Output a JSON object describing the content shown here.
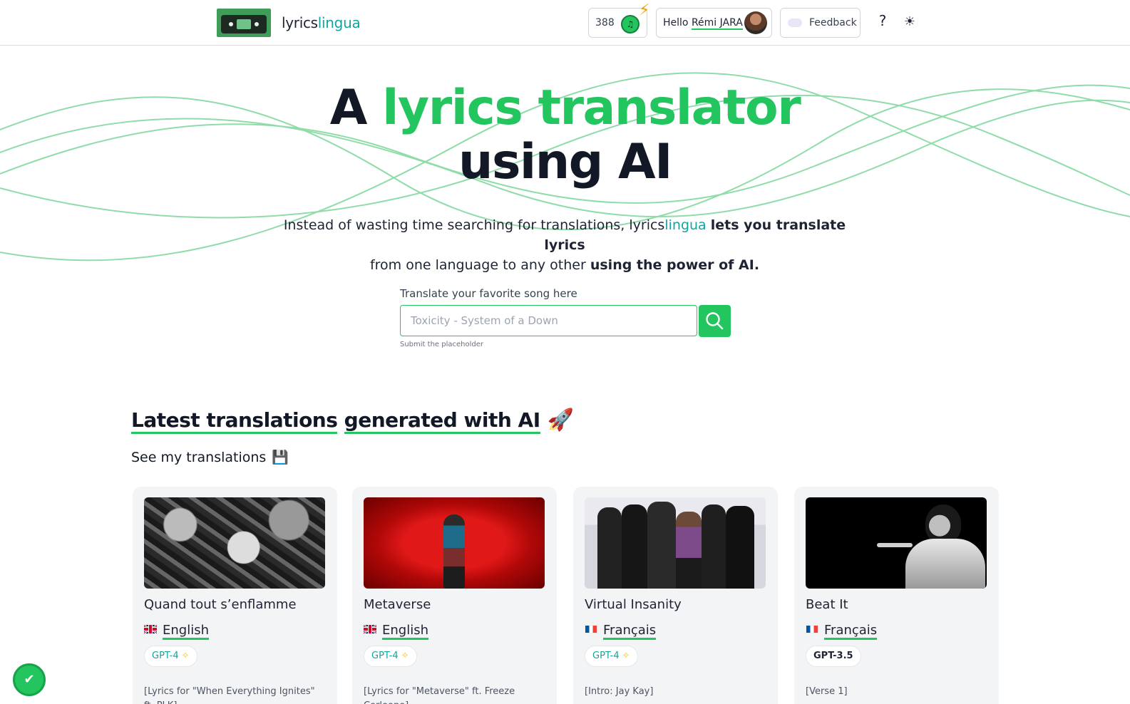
{
  "header": {
    "logo_prefix": "lyrics",
    "logo_accent": "lingua",
    "credits": "388",
    "coin_glyph": "♫",
    "hello_prefix": "Hello",
    "user_name": "Rémi JARA",
    "feedback_label": "Feedback",
    "help_label": "?",
    "theme_icon": "sun-icon"
  },
  "hero": {
    "title_prefix": "A",
    "title_accent": "lyrics translator",
    "title_line2": "using AI",
    "sub_1": "Instead of wasting time searching for translations,",
    "sub_brand_prefix": "lyrics",
    "sub_brand_accent": "lingua",
    "sub_2": "lets you translate lyrics",
    "sub_3": "from one language to any other",
    "sub_4": "using the power of AI."
  },
  "search": {
    "label": "Translate your favorite song here",
    "placeholder": "Toxicity - System of a Down",
    "hint": "Submit the placeholder"
  },
  "latest": {
    "title_part1": "Latest translations",
    "title_part2": "generated with AI",
    "title_emoji": "🚀",
    "my_translations": "See my translations",
    "my_emoji": "💾"
  },
  "cards": [
    {
      "title": "Quand tout s’enflamme",
      "language": "English",
      "flag": "uk",
      "model": "GPT-4",
      "snippet": "[Lyrics for \"When Everything Ignites\" ft. PLK]"
    },
    {
      "title": "Metaverse",
      "language": "English",
      "flag": "uk",
      "model": "GPT-4",
      "snippet": "[Lyrics for \"Metaverse\" ft. Freeze Corleone]"
    },
    {
      "title": "Virtual Insanity",
      "language": "Français",
      "flag": "fr",
      "model": "GPT-4",
      "snippet": "[Intro: Jay Kay]"
    },
    {
      "title": "Beat It",
      "language": "Français",
      "flag": "fr",
      "model": "GPT-3.5",
      "snippet": "[Verse 1]"
    }
  ],
  "colors": {
    "accent_green": "#22c55e",
    "brand_teal": "#14a4a0",
    "text_dark": "#121826"
  }
}
